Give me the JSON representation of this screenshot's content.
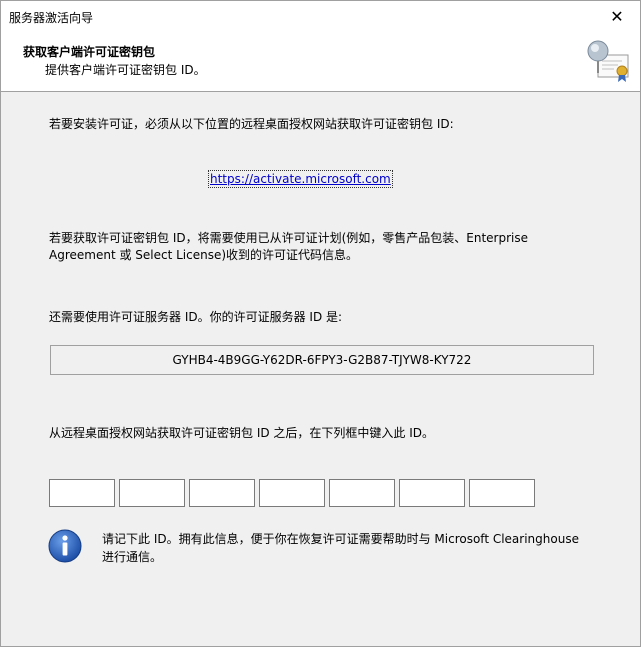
{
  "window": {
    "title": "服务器激活向导"
  },
  "header": {
    "title": "获取客户端许可证密钥包",
    "subtitle": "提供客户端许可证密钥包 ID。"
  },
  "main": {
    "intro": "若要安装许可证，必须从以下位置的远程桌面授权网站获取许可证密钥包 ID:",
    "link": "https://activate.microsoft.com",
    "para_line1": "若要获取许可证密钥包 ID，将需要使用已从许可证计划(例如，零售产品包装、Enterprise",
    "para_line2": "Agreement 或 Select License)收到的许可证代码信息。",
    "server_label": "还需要使用许可证服务器 ID。你的许可证服务器 ID 是:",
    "server_id": "GYHB4-4B9GG-Y62DR-6FPY3-G2B87-TJYW8-KY722",
    "enter_label": "从远程桌面授权网站获取许可证密钥包 ID 之后，在下列框中键入此 ID。",
    "key_fields": [
      "",
      "",
      "",
      "",
      "",
      "",
      ""
    ],
    "info_line1": "请记下此 ID。拥有此信息，便于你在恢复许可证需要帮助时与 Microsoft Clearinghouse",
    "info_line2": "进行通信。"
  },
  "icons": {
    "close": "close-icon",
    "header": "certificate-icon",
    "info": "info-icon"
  }
}
